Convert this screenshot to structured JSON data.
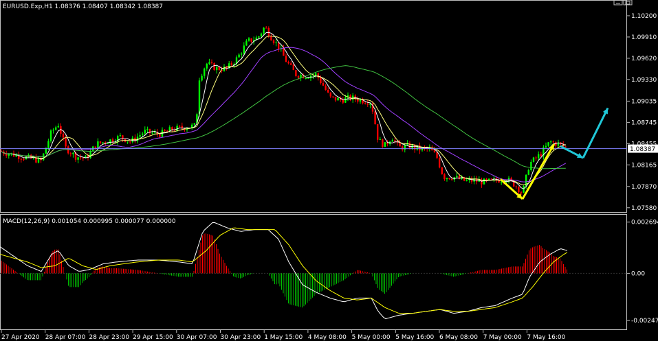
{
  "chart_data": {
    "type": "candlestick",
    "symbol_header": "EURUSD.Exp,H1  1.08376 1.08407 1.08342 1.08387",
    "current_price": {
      "value": 1.08387,
      "label": "1.08387"
    },
    "price_ticks": [
      {
        "value": 1.102,
        "label": "1.10200"
      },
      {
        "value": 1.0991,
        "label": "1.09910"
      },
      {
        "value": 1.0962,
        "label": "1.09620"
      },
      {
        "value": 1.0933,
        "label": "1.09330"
      },
      {
        "value": 1.09035,
        "label": "1.09035"
      },
      {
        "value": 1.08745,
        "label": "1.08745"
      },
      {
        "value": 1.08455,
        "label": "1.08455"
      },
      {
        "value": 1.08165,
        "label": "1.08165"
      },
      {
        "value": 1.0787,
        "label": "1.07870"
      },
      {
        "value": 1.0758,
        "label": "1.07580"
      }
    ],
    "price_range": [
      1.0755,
      1.1034
    ],
    "time_ticks": [
      "27 Apr 2020",
      "28 Apr 07:00",
      "28 Apr 23:00",
      "29 Apr 15:00",
      "30 Apr 07:00",
      "30 Apr 23:00",
      "1 May 15:00",
      "4 May 08:00",
      "5 May 00:00",
      "5 May 16:00",
      "6 May 08:00",
      "7 May 00:00",
      "7 May 16:00"
    ],
    "price_path": [
      [
        0,
        1.0835
      ],
      [
        30,
        1.0828
      ],
      [
        60,
        1.0822
      ],
      [
        75,
        1.0862
      ],
      [
        85,
        1.0872
      ],
      [
        95,
        1.084
      ],
      [
        110,
        1.0828
      ],
      [
        125,
        1.0825
      ],
      [
        140,
        1.0845
      ],
      [
        160,
        1.085
      ],
      [
        175,
        1.0855
      ],
      [
        190,
        1.0848
      ],
      [
        210,
        1.0862
      ],
      [
        230,
        1.0858
      ],
      [
        250,
        1.0865
      ],
      [
        270,
        1.0868
      ],
      [
        285,
        1.087
      ],
      [
        290,
        1.0935
      ],
      [
        300,
        1.0955
      ],
      [
        315,
        1.0948
      ],
      [
        330,
        1.0948
      ],
      [
        345,
        1.0962
      ],
      [
        360,
        1.0985
      ],
      [
        375,
        1.099
      ],
      [
        385,
        1.1005
      ],
      [
        395,
        1.099
      ],
      [
        405,
        1.0978
      ],
      [
        415,
        1.096
      ],
      [
        430,
        1.094
      ],
      [
        445,
        1.0938
      ],
      [
        460,
        1.094
      ],
      [
        470,
        1.0925
      ],
      [
        480,
        1.0908
      ],
      [
        495,
        1.0905
      ],
      [
        510,
        1.0908
      ],
      [
        525,
        1.0905
      ],
      [
        540,
        1.0902
      ],
      [
        550,
        1.085
      ],
      [
        560,
        1.0843
      ],
      [
        570,
        1.0855
      ],
      [
        580,
        1.084
      ],
      [
        595,
        1.0842
      ],
      [
        610,
        1.0838
      ],
      [
        625,
        1.0838
      ],
      [
        635,
        1.0828
      ],
      [
        645,
        1.08
      ],
      [
        660,
        1.08
      ],
      [
        675,
        1.0795
      ],
      [
        690,
        1.0795
      ],
      [
        705,
        1.0793
      ],
      [
        720,
        1.0795
      ],
      [
        735,
        1.0798
      ],
      [
        748,
        1.079
      ],
      [
        760,
        1.0778
      ],
      [
        770,
        1.0818
      ],
      [
        785,
        1.083
      ],
      [
        800,
        1.0848
      ],
      [
        812,
        1.0845
      ],
      [
        822,
        1.084
      ]
    ],
    "macd": {
      "label": "MACD(12,26,9) 0.001054 0.000995 0.000077 0.000000",
      "ticks": [
        {
          "value": 0.002694,
          "label": "0.002694"
        },
        {
          "value": 0.0,
          "label": "0.00"
        },
        {
          "value": -0.002479,
          "label": "-0.002479"
        }
      ],
      "range": [
        -0.0028,
        0.0029
      ],
      "main": [
        [
          0,
          0.0014
        ],
        [
          20,
          0.0009
        ],
        [
          40,
          0.0004
        ],
        [
          60,
          0.0001
        ],
        [
          75,
          0.001
        ],
        [
          85,
          0.0012
        ],
        [
          100,
          0.0004
        ],
        [
          115,
          0.0001
        ],
        [
          130,
          0.0002
        ],
        [
          150,
          0.0005
        ],
        [
          170,
          0.0006
        ],
        [
          200,
          0.0007
        ],
        [
          230,
          0.0007
        ],
        [
          260,
          0.0006
        ],
        [
          280,
          0.0005
        ],
        [
          295,
          0.0022
        ],
        [
          310,
          0.0027
        ],
        [
          330,
          0.0024
        ],
        [
          350,
          0.0022
        ],
        [
          370,
          0.0023
        ],
        [
          390,
          0.0023
        ],
        [
          405,
          0.0018
        ],
        [
          420,
          0.0006
        ],
        [
          440,
          -0.0006
        ],
        [
          460,
          -0.001
        ],
        [
          480,
          -0.0013
        ],
        [
          500,
          -0.0015
        ],
        [
          520,
          -0.0013
        ],
        [
          540,
          -0.0013
        ],
        [
          550,
          -0.002
        ],
        [
          560,
          -0.0024
        ],
        [
          580,
          -0.0022
        ],
        [
          600,
          -0.0021
        ],
        [
          620,
          -0.002
        ],
        [
          640,
          -0.0019
        ],
        [
          660,
          -0.0021
        ],
        [
          680,
          -0.002
        ],
        [
          700,
          -0.0018
        ],
        [
          720,
          -0.0017
        ],
        [
          745,
          -0.0013
        ],
        [
          760,
          -0.0011
        ],
        [
          770,
          -0.0002
        ],
        [
          785,
          0.0006
        ],
        [
          800,
          0.001
        ],
        [
          815,
          0.0013
        ],
        [
          825,
          0.0012
        ]
      ],
      "signal": [
        [
          0,
          0.001
        ],
        [
          20,
          0.0008
        ],
        [
          40,
          0.0006
        ],
        [
          60,
          0.0003
        ],
        [
          80,
          0.0004
        ],
        [
          100,
          0.0008
        ],
        [
          120,
          0.0004
        ],
        [
          140,
          0.0002
        ],
        [
          160,
          0.0004
        ],
        [
          180,
          0.0005
        ],
        [
          200,
          0.0006
        ],
        [
          230,
          0.0007
        ],
        [
          260,
          0.0007
        ],
        [
          280,
          0.0006
        ],
        [
          300,
          0.0012
        ],
        [
          320,
          0.002
        ],
        [
          340,
          0.0024
        ],
        [
          360,
          0.0023
        ],
        [
          380,
          0.0023
        ],
        [
          400,
          0.0023
        ],
        [
          420,
          0.0015
        ],
        [
          440,
          0.0004
        ],
        [
          460,
          -0.0004
        ],
        [
          480,
          -0.0009
        ],
        [
          500,
          -0.0013
        ],
        [
          520,
          -0.0014
        ],
        [
          540,
          -0.0013
        ],
        [
          560,
          -0.0018
        ],
        [
          580,
          -0.0021
        ],
        [
          600,
          -0.0021
        ],
        [
          620,
          -0.002
        ],
        [
          640,
          -0.0019
        ],
        [
          660,
          -0.002
        ],
        [
          680,
          -0.002
        ],
        [
          700,
          -0.0019
        ],
        [
          720,
          -0.0018
        ],
        [
          745,
          -0.0015
        ],
        [
          760,
          -0.0013
        ],
        [
          775,
          -0.0007
        ],
        [
          790,
          0.0
        ],
        [
          805,
          0.0006
        ],
        [
          820,
          0.001
        ],
        [
          825,
          0.0011
        ]
      ]
    },
    "colors": {
      "background": "#000000",
      "bull": "#00ff00",
      "bear": "#ff0000",
      "ma_fast": "#ffffff",
      "ma_mid": "#ffff80",
      "ma_purple": "#a040ff",
      "ma_slow": "#40c040",
      "hline": "#8080ff",
      "arrow_yellow": "#ffff00",
      "arrow_cyan": "#20c8d8",
      "macd_signal": "#ffff00",
      "hist_pos": "#ff0000",
      "hist_neg": "#00c000"
    }
  }
}
